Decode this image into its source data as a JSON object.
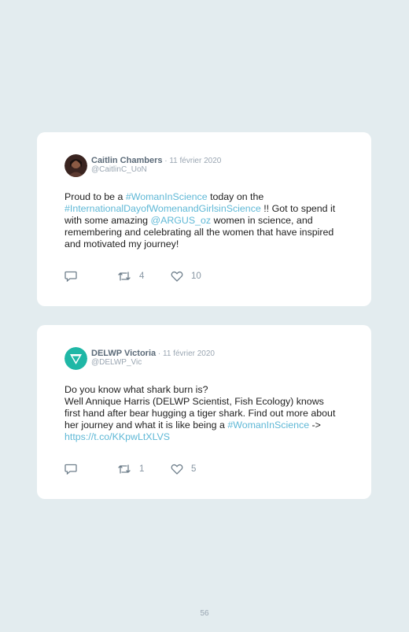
{
  "tweets": [
    {
      "name": "Caitlin Chambers",
      "date": "11 février 2020",
      "handle": "@CaitlinC_UoN",
      "body": [
        {
          "t": "Proud to be a ",
          "link": false
        },
        {
          "t": "#WomanInScience",
          "link": true
        },
        {
          "t": " today on the ",
          "link": false
        },
        {
          "t": "#InternationalDayofWomenandGirlsinScience",
          "link": true
        },
        {
          "t": " !! Got to spend it with some amazing ",
          "link": false
        },
        {
          "t": "@ARGUS_oz",
          "link": true
        },
        {
          "t": " women in science, and remembering and celebrating all the women that have inspired and motivated my journey!",
          "link": false
        }
      ],
      "replies": "",
      "retweets": "4",
      "likes": "10"
    },
    {
      "name": "DELWP Victoria",
      "date": "11 février 2020",
      "handle": "@DELWP_Vic",
      "body": [
        {
          "t": "Do you know what shark burn is?\nWell Annique Harris (DELWP Scientist, Fish Ecology) knows first hand after bear hugging a tiger shark. Find out more about her journey and what it is like being a ",
          "link": false
        },
        {
          "t": "#WomanInScience",
          "link": true
        },
        {
          "t": " -> ",
          "link": false
        },
        {
          "t": "https://t.co/KKpwLtXLVS",
          "link": true
        }
      ],
      "replies": "",
      "retweets": "1",
      "likes": "5"
    }
  ],
  "page_number": "56",
  "colors": {
    "background": "#e3ecef",
    "link": "#5fb8d6",
    "card": "#ffffff"
  },
  "icons": [
    "reply-icon",
    "retweet-icon",
    "like-icon"
  ]
}
